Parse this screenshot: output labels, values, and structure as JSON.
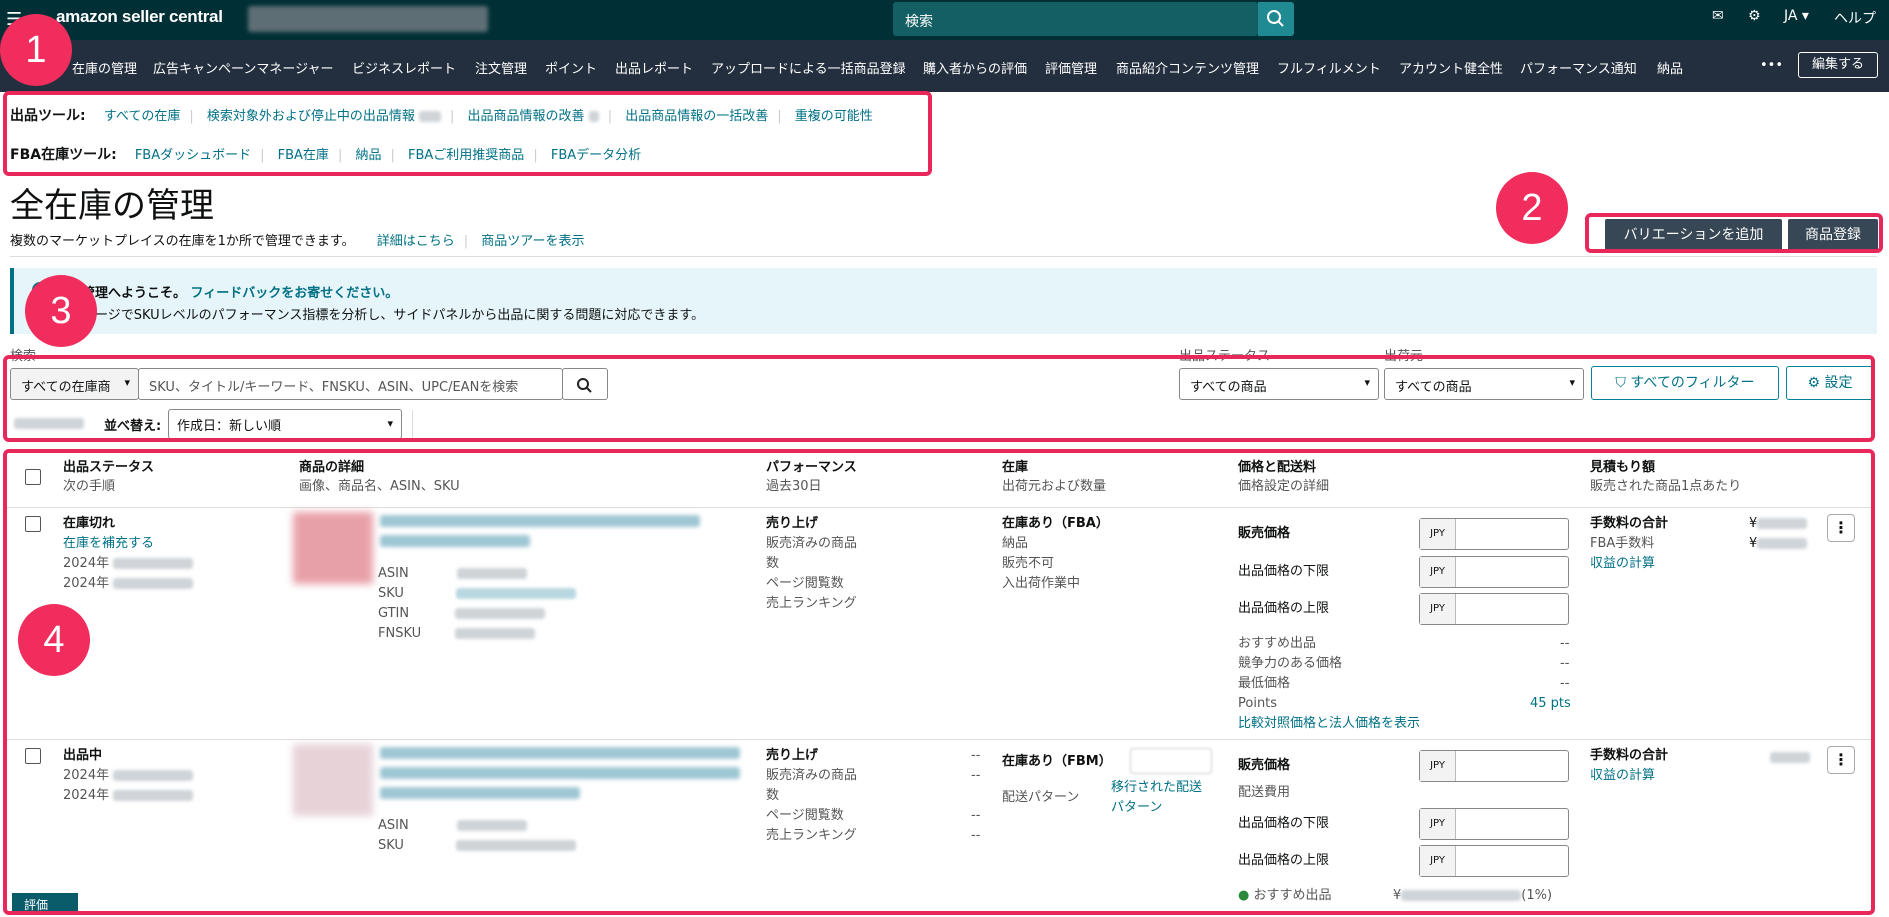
{
  "topbar": {
    "logo": "amazon seller central",
    "search": "検索",
    "lang": "JA",
    "help": "ヘルプ"
  },
  "nav": [
    "在庫の管理",
    "広告キャンペーンマネージャー",
    "ビジネスレポート",
    "注文管理",
    "ポイント",
    "出品レポート",
    "アップロードによる一括商品登録",
    "購入者からの評価",
    "評価管理",
    "商品紹介コンテンツ管理",
    "フルフィルメント",
    "アカウント健全性",
    "パフォーマンス通知",
    "納品"
  ],
  "nav_more": "•••",
  "nav_edit": "編集する",
  "tools": {
    "listing_label": "出品ツール:",
    "listing_links": [
      "すべての在庫",
      "検索対象外および停止中の出品情報",
      "出品商品情報の改善",
      "出品商品情報の一括改善",
      "重複の可能性"
    ],
    "fba_label": "FBA在庫ツール:",
    "fba_links": [
      "FBAダッシュボード",
      "FBA在庫",
      "納品",
      "FBAご利用推奨商品",
      "FBAデータ分析"
    ]
  },
  "page": {
    "title": "全在庫の管理",
    "subtitle": "複数のマーケットプレイスの在庫を1か所で管理できます。",
    "learn_more": "詳細はこちら",
    "tour": "商品ツアーを表示",
    "add_variation": "バリエーションを追加",
    "add_product": "商品登録"
  },
  "info": {
    "welcome": "在庫管理へようこそ。",
    "feedback": "フィードバックをお寄せください。",
    "text": "このページでSKUレベルのパフォーマンス指標を分析し、サイドパネルから出品に関する問題に対応できます。"
  },
  "filters": {
    "search_label": "検索",
    "scope": "すべての在庫商",
    "placeholder": "SKU、タイトル/キーワード、FNSKU、ASIN、UPC/EANを検索",
    "status_label": "出品ステータス",
    "status_value": "すべての商品",
    "ship_label": "出荷元",
    "ship_value": "すべての商品",
    "all_filters": "すべてのフィルター",
    "settings": "設定",
    "sort_label": "並べ替え:",
    "sort_value": "作成日：新しい順"
  },
  "headers": [
    {
      "t": "出品ステータス",
      "s": "次の手順"
    },
    {
      "t": "商品の詳細",
      "s": "画像、商品名、ASIN、SKU"
    },
    {
      "t": "パフォーマンス",
      "s": "過去30日"
    },
    {
      "t": "在庫",
      "s": "出荷元および数量"
    },
    {
      "t": "価格と配送料",
      "s": "価格設定の詳細"
    },
    {
      "t": "見積もり額",
      "s": "販売された商品1点あたり"
    }
  ],
  "rows": [
    {
      "status": "在庫切れ",
      "action": "在庫を補充する",
      "date1": "2024年",
      "date2": "2024年",
      "ids": [
        "ASIN",
        "SKU",
        "GTIN",
        "FNSKU"
      ],
      "perf": [
        "売り上げ",
        "販売済みの商品",
        "数",
        "ページ閲覧数",
        "売上ランキング"
      ],
      "stock": "在庫あり（FBA）",
      "stock_items": [
        "納品",
        "販売不可",
        "入出荷作業中"
      ],
      "price_label": "販売価格",
      "min_label": "出品価格の下限",
      "max_label": "出品価格の上限",
      "currency": "JPY",
      "extra": [
        "おすすめ出品",
        "競争力のある価格",
        "最低価格",
        "Points"
      ],
      "dash": "--",
      "points": "45 pts",
      "compare": "比較対照価格と法人価格を表示",
      "fee_total": "手数料の合計",
      "fba_fee": "FBA手数料",
      "yen": "¥",
      "profit": "収益の計算"
    },
    {
      "status": "出品中",
      "date1": "2024年",
      "date2": "2024年",
      "ids": [
        "ASIN",
        "SKU"
      ],
      "perf": [
        "売り上げ",
        "販売済みの商品",
        "数",
        "ページ閲覧数",
        "売上ランキング"
      ],
      "dash": "--",
      "stock": "在庫あり（FBM）",
      "ship_pattern": "配送パターン",
      "migrated": "移行された配送",
      "migrated2": "パターン",
      "price_label": "販売価格",
      "ship_fee": "配送費用",
      "min_label": "出品価格の下限",
      "max_label": "出品価格の上限",
      "currency": "JPY",
      "recommend": "おすすめ出品",
      "recommend_val": "¥",
      "recommend_pct": "(1%)",
      "fee_total": "手数料の合計",
      "profit": "収益の計算"
    }
  ],
  "badges": [
    "1",
    "2",
    "3",
    "4"
  ],
  "bottom_tab": "評価"
}
